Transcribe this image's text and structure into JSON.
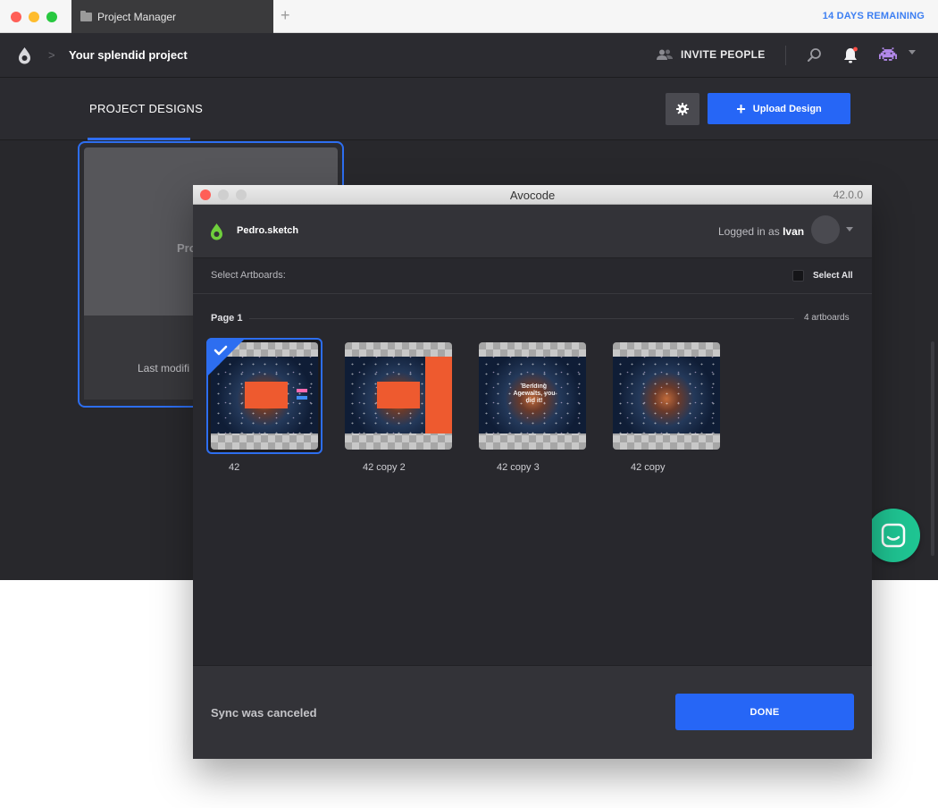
{
  "browser": {
    "tab_title": "Project Manager",
    "new_tab_symbol": "+",
    "trial_notice": "14 DAYS REMAINING",
    "traffic_colors": [
      "#ff5f57",
      "#febc2e",
      "#28c840"
    ]
  },
  "app": {
    "breadcrumb_chevron": ">",
    "project_name": "Your splendid project",
    "invite_label": "INVITE PEOPLE",
    "icons": {
      "logo": "avocode-logo-icon",
      "search": "search-icon",
      "notifications": "bell-icon",
      "avatar": "space-invader-avatar-icon",
      "settings": "gear-icon",
      "chat": "chat-icon"
    },
    "tabs": [
      {
        "label": "PROJECT DESIGNS",
        "active": true
      }
    ],
    "upload_label": "Upload Design",
    "upload_symbol": "+",
    "design_card": {
      "thumb_label": "Pro",
      "modified_label": "Last modifi"
    },
    "accent_color": "#2666f6",
    "chat_color": "#1fc492"
  },
  "dialog": {
    "window_title": "Avocode",
    "version": "42.0.0",
    "file_name": "Pedro.sketch",
    "logged_in_prefix": "Logged in as ",
    "user_name": "Ivan",
    "select_label": "Select Artboards:",
    "select_all_label": "Select All",
    "page_label": "Page 1",
    "artboard_count": "4 artboards",
    "artboards": [
      {
        "name": "42",
        "selected": true,
        "headline": ""
      },
      {
        "name": "42 copy 2",
        "selected": false,
        "headline": ""
      },
      {
        "name": "42 copy 3",
        "selected": false,
        "headline": "Bending Agewalts, you did it!"
      },
      {
        "name": "42 copy",
        "selected": false,
        "headline": ""
      }
    ],
    "sync_status": "Sync was canceled",
    "done_label": "DONE"
  }
}
